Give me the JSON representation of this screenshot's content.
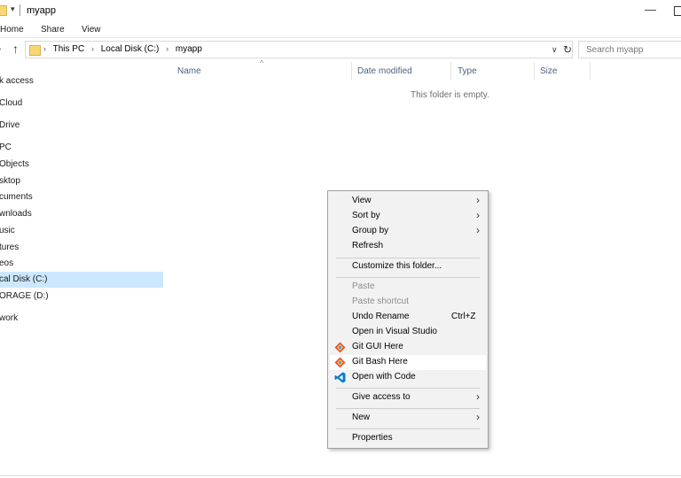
{
  "window": {
    "title": "myapp",
    "quick_access_arrow": "▾",
    "min_glyph": "—"
  },
  "ribbon": {
    "tabs": [
      "Home",
      "Share",
      "View"
    ]
  },
  "address": {
    "back_glyph": "›",
    "up_glyph": "↑",
    "crumbs": [
      "This PC",
      "Local Disk (C:)",
      "myapp"
    ],
    "crumb_sep": "›",
    "dropdown_glyph": "∨",
    "refresh_glyph": "↻",
    "search_placeholder": "Search myapp"
  },
  "nav": {
    "items": [
      {
        "label": "k access"
      },
      {
        "label": "Cloud"
      },
      {
        "label": "Drive"
      },
      {
        "label": "PC"
      },
      {
        "label": "Objects"
      },
      {
        "label": "sktop"
      },
      {
        "label": "cuments"
      },
      {
        "label": "wnloads"
      },
      {
        "label": "usic"
      },
      {
        "label": "tures"
      },
      {
        "label": "eos"
      },
      {
        "label": "cal Disk (C:)",
        "selected": true
      },
      {
        "label": "ORAGE (D:)"
      },
      {
        "label": "work"
      }
    ]
  },
  "columns": {
    "name": "Name",
    "date": "Date modified",
    "type": "Type",
    "size": "Size",
    "sort_glyph": "^"
  },
  "content": {
    "empty_message": "This folder is empty."
  },
  "context_menu": {
    "items": [
      {
        "label": "View",
        "submenu": true
      },
      {
        "label": "Sort by",
        "submenu": true
      },
      {
        "label": "Group by",
        "submenu": true
      },
      {
        "label": "Refresh"
      },
      {
        "label": "Customize this folder..."
      },
      {
        "label": "Paste",
        "disabled": true
      },
      {
        "label": "Paste shortcut",
        "disabled": true
      },
      {
        "label": "Undo Rename",
        "shortcut": "Ctrl+Z"
      },
      {
        "label": "Open in Visual Studio"
      },
      {
        "label": "Git GUI Here",
        "icon": "git-icon"
      },
      {
        "label": "Git Bash Here",
        "icon": "git-icon",
        "hover": true
      },
      {
        "label": "Open with Code",
        "icon": "vscode-icon"
      },
      {
        "label": "Give access to",
        "submenu": true
      },
      {
        "label": "New",
        "submenu": true
      },
      {
        "label": "Properties"
      }
    ],
    "arrow_glyph": "›"
  },
  "colors": {
    "selection": "#cce8ff",
    "folder": "#f8d775",
    "header_text": "#4d6082",
    "vscode_blue": "#0a7acc",
    "git_orange": "#f05033"
  }
}
